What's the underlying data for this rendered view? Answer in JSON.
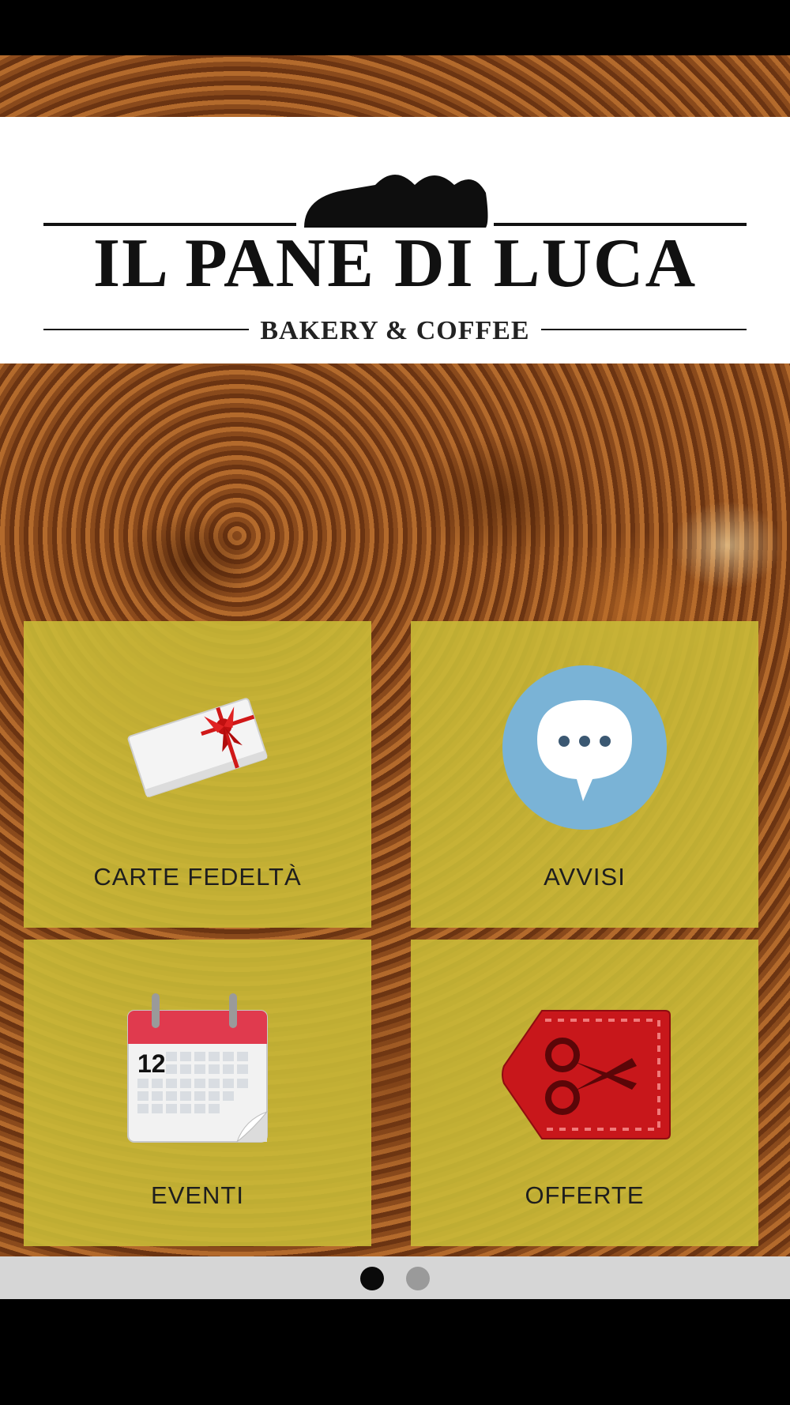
{
  "logo": {
    "title": "IL PANE DI LUCA",
    "subtitle": "BAKERY & COFFEE"
  },
  "menu": {
    "tiles": [
      {
        "label": "CARTE FEDELTÀ",
        "icon": "gift-card-icon"
      },
      {
        "label": "AVVISI",
        "icon": "chat-bubble-icon"
      },
      {
        "label": "EVENTI",
        "icon": "calendar-icon"
      },
      {
        "label": "OFFERTE",
        "icon": "coupon-scissors-icon"
      }
    ],
    "tile_color": "#c9ba37"
  },
  "calendar": {
    "day": "12"
  },
  "pager": {
    "pages": 2,
    "current": 1
  }
}
